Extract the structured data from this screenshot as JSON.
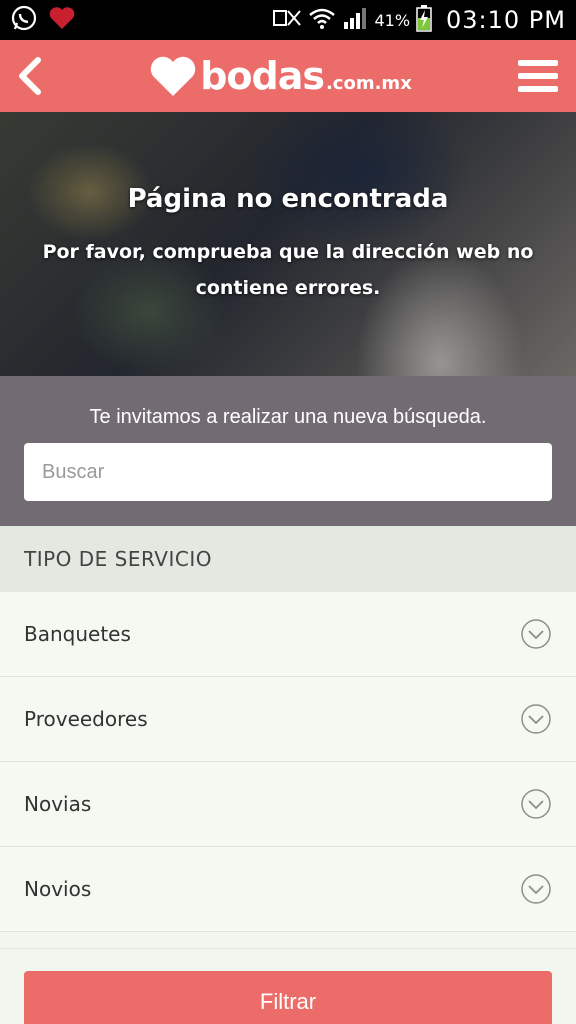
{
  "status_bar": {
    "battery": "41%",
    "time": "03:10 PM",
    "icons": [
      "whatsapp-icon",
      "heart-icon",
      "no-sim-icon",
      "wifi-icon",
      "signal-icon",
      "battery-icon"
    ]
  },
  "header": {
    "logo_word": "bodas",
    "logo_suffix": ".com.mx",
    "brand_color": "#ec6c6a",
    "icons": [
      "back-arrow-icon",
      "heart-logo-icon",
      "hamburger-menu-icon"
    ]
  },
  "hero": {
    "title": "Página no encontrada",
    "subtitle": "Por favor, comprueba que la dirección web no contiene errores."
  },
  "search": {
    "invite": "Te invitamos a realizar una nueva búsqueda.",
    "placeholder": "Buscar"
  },
  "filters": {
    "section_title": "TIPO DE SERVICIO",
    "items": [
      {
        "label": "Banquetes"
      },
      {
        "label": "Proveedores"
      },
      {
        "label": "Novias"
      },
      {
        "label": "Novios"
      }
    ],
    "button_label": "Filtrar"
  }
}
